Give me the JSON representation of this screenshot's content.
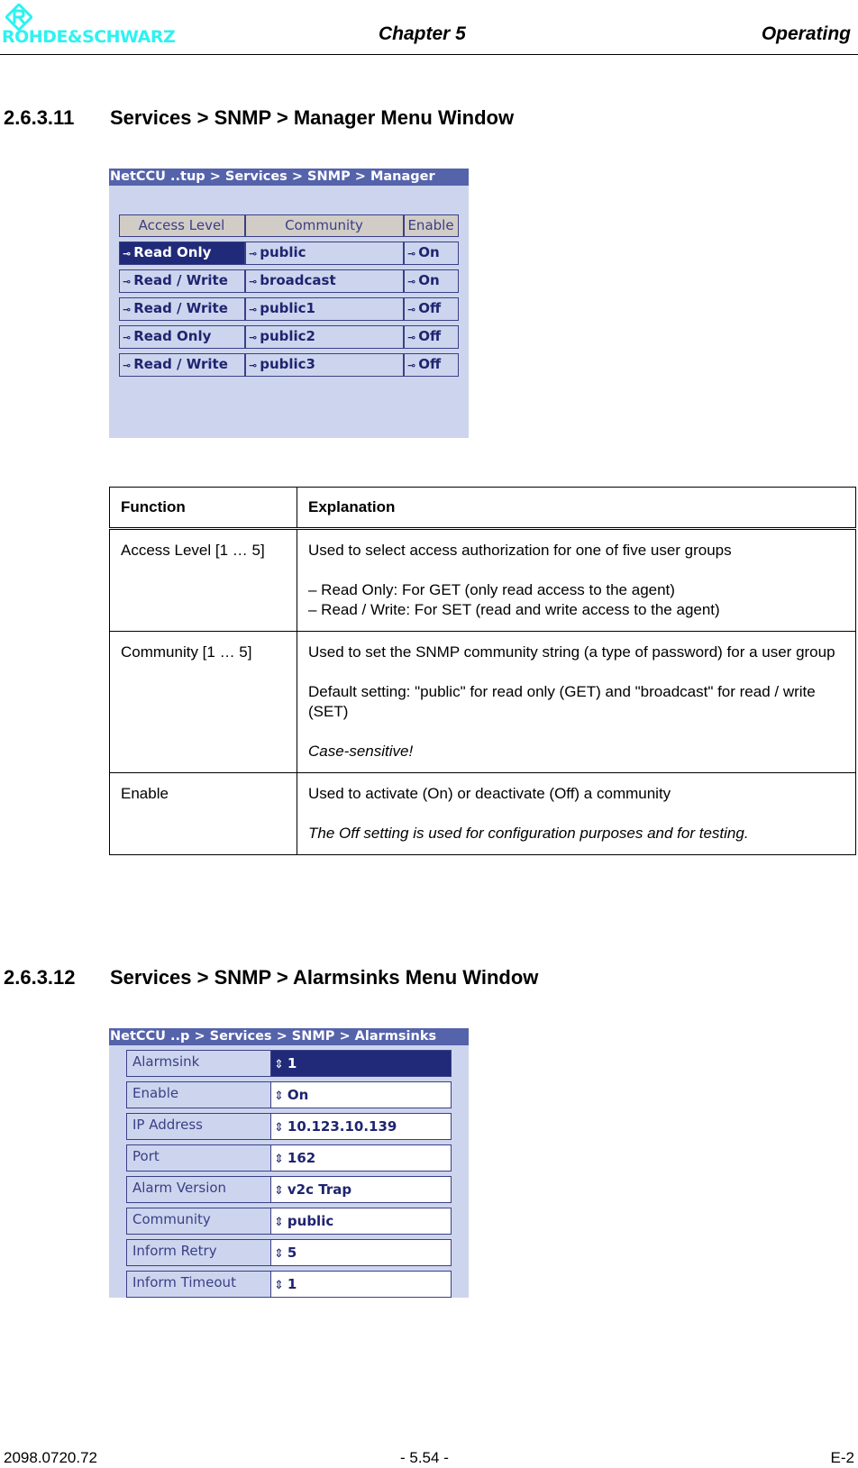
{
  "header": {
    "logo_text": "ROHDE&SCHWARZ",
    "chapter": "Chapter 5",
    "section": "Operating",
    "brand_color": "#2ef2f2"
  },
  "sections": [
    {
      "number": "2.6.3.11",
      "title": "Services > SNMP > Manager Menu Window"
    },
    {
      "number": "2.6.3.12",
      "title": "Services > SNMP > Alarmsinks Menu Window"
    }
  ],
  "manager_screen": {
    "title": "NetCCU ..tup > Services > SNMP > Manager",
    "columns": [
      "Access Level",
      "Community",
      "Enable"
    ],
    "key_icon": "⊸",
    "rows": [
      {
        "access": "Read Only",
        "community": "public",
        "enable": "On",
        "selected": true
      },
      {
        "access": "Read / Write",
        "community": "broadcast",
        "enable": "On",
        "selected": false
      },
      {
        "access": "Read / Write",
        "community": "public1",
        "enable": "Off",
        "selected": false
      },
      {
        "access": "Read Only",
        "community": "public2",
        "enable": "Off",
        "selected": false
      },
      {
        "access": "Read / Write",
        "community": "public3",
        "enable": "Off",
        "selected": false
      }
    ]
  },
  "explanation_table": {
    "headers": [
      "Function",
      "Explanation"
    ],
    "rows": [
      {
        "function": "Access Level [1 … 5]",
        "lines": [
          "Used to select access authorization for one of five user groups",
          "–  Read Only: For GET (only read access to the agent)",
          "–  Read / Write: For SET (read and write access to the agent)"
        ]
      },
      {
        "function": "Community [1 … 5]",
        "lines": [
          "Used to set the SNMP community string (a type of password) for a user group",
          "Default setting: \"public\" for read only (GET) and \"broadcast\" for read / write (SET)",
          "Case-sensitive!"
        ]
      },
      {
        "function": "Enable",
        "lines": [
          "Used to activate (On) or deactivate (Off) a community",
          "The Off setting is used for configuration purposes and for testing."
        ]
      }
    ]
  },
  "alarmsinks_screen": {
    "title": "NetCCU ..p > Services > SNMP > Alarmsinks",
    "spin_icon": "⇕",
    "fields": [
      {
        "label": "Alarmsink",
        "value": "1",
        "selected": true
      },
      {
        "label": "Enable",
        "value": "On",
        "selected": false
      },
      {
        "label": "IP Address",
        "value": "10.123.10.139",
        "selected": false
      },
      {
        "label": "Port",
        "value": "162",
        "selected": false
      },
      {
        "label": "Alarm Version",
        "value": "v2c Trap",
        "selected": false
      },
      {
        "label": "Community",
        "value": "public",
        "selected": false
      },
      {
        "label": "Inform Retry",
        "value": "5",
        "selected": false
      },
      {
        "label": "Inform Timeout",
        "value": "1",
        "selected": false
      }
    ]
  },
  "footer": {
    "doc_number": "2098.0720.72",
    "page": "- 5.54 -",
    "edition": "E-2"
  }
}
